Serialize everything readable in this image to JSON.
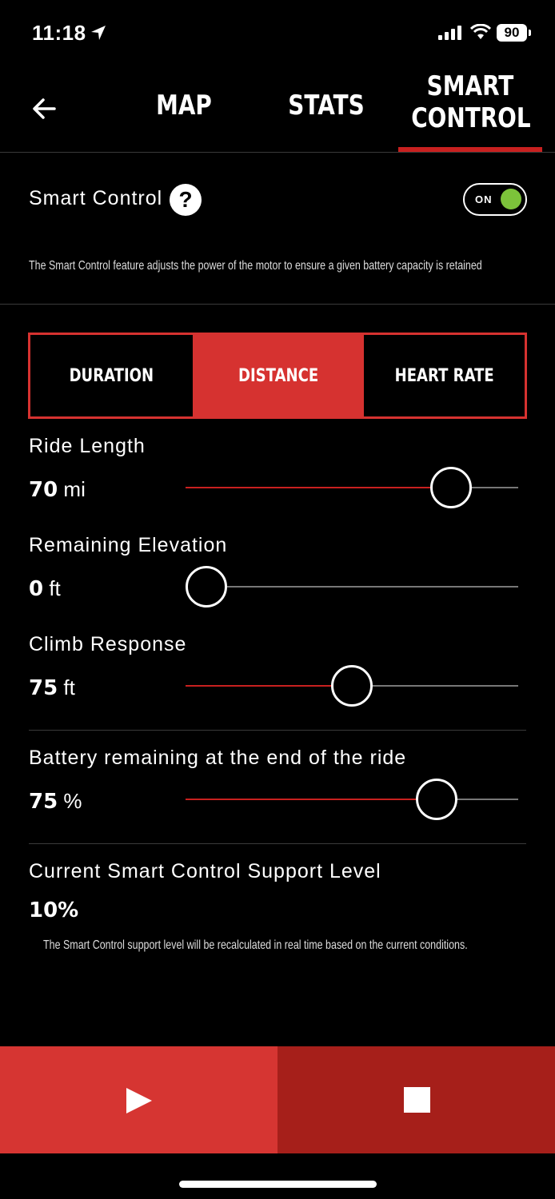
{
  "status": {
    "time": "11:18",
    "battery": "90"
  },
  "nav": {
    "tabs": [
      {
        "label": "MAP"
      },
      {
        "label": "STATS"
      },
      {
        "label_line1": "SMART",
        "label_line2": "CONTROL"
      }
    ],
    "active_tab": "SMART CONTROL"
  },
  "smart_control": {
    "label": "Smart Control",
    "toggle_text": "ON",
    "toggle_on": true,
    "description": "The Smart Control feature adjusts the power of the motor to ensure a given battery capacity is retained"
  },
  "segments": [
    {
      "label": "DURATION",
      "selected": false
    },
    {
      "label": "DISTANCE",
      "selected": true
    },
    {
      "label": "HEART RATE",
      "selected": false
    }
  ],
  "sliders": {
    "ride_length": {
      "label": "Ride Length",
      "value": "70",
      "unit": "mi",
      "fraction": 0.84
    },
    "remaining_elevation": {
      "label": "Remaining Elevation",
      "value": "0",
      "unit": "ft",
      "fraction": 0.0
    },
    "climb_response": {
      "label": "Climb Response",
      "value": "75",
      "unit": "ft",
      "fraction": 0.5
    },
    "battery_remaining": {
      "label": "Battery remaining at the end of the ride",
      "value": "75",
      "unit": "%",
      "fraction": 0.79
    }
  },
  "support": {
    "label": "Current Smart Control Support Level",
    "value": "10%",
    "note": "The Smart Control support level will be recalculated in real time based on the current conditions."
  },
  "colors": {
    "accent": "#d63230",
    "accent_dark": "#a61f1a",
    "toggle_green": "#7cc33a"
  },
  "icons": {
    "back": "arrow-left-icon",
    "help": "question-icon",
    "play": "play-icon",
    "stop": "stop-icon"
  }
}
